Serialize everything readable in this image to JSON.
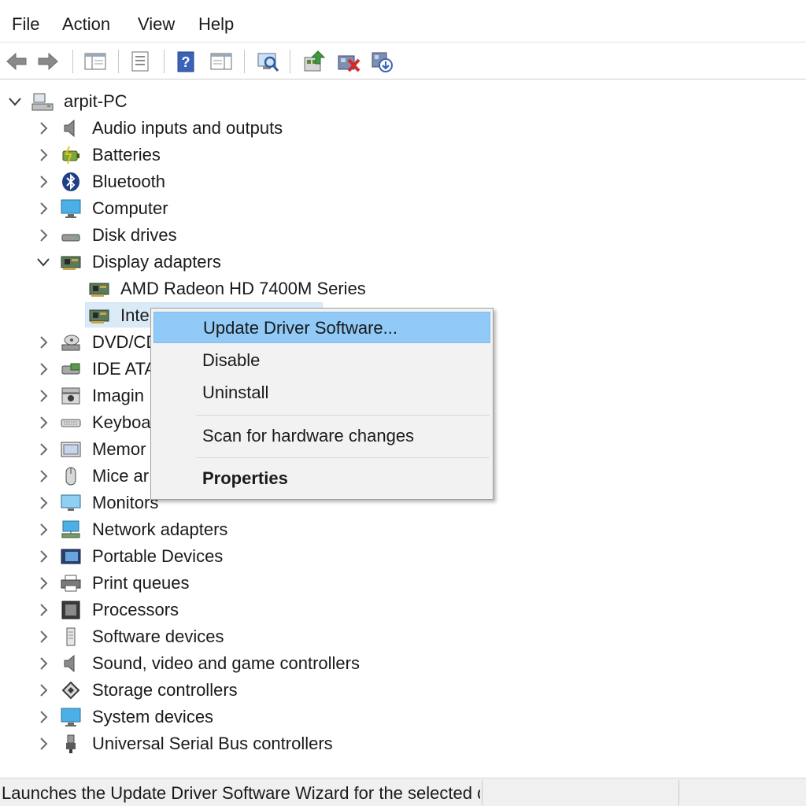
{
  "menubar": {
    "items": [
      {
        "label": "File"
      },
      {
        "label": "Action"
      },
      {
        "label": "View"
      },
      {
        "label": "Help"
      }
    ]
  },
  "toolbar": {
    "buttons": [
      {
        "icon": "back-arrow-icon"
      },
      {
        "icon": "forward-arrow-icon"
      },
      {
        "icon": "show-hide-console-tree-icon"
      },
      {
        "icon": "properties-icon"
      },
      {
        "icon": "help-icon"
      },
      {
        "icon": "action-pane-icon"
      },
      {
        "icon": "scan-hardware-changes-icon"
      },
      {
        "icon": "update-driver-icon"
      },
      {
        "icon": "uninstall-device-icon"
      },
      {
        "icon": "add-legacy-hardware-icon"
      }
    ]
  },
  "tree": {
    "root": {
      "label": "arpit-PC",
      "icon": "computer-icon"
    },
    "nodes": [
      {
        "label": "Audio inputs and outputs",
        "icon": "speaker-icon"
      },
      {
        "label": "Batteries",
        "icon": "battery-icon"
      },
      {
        "label": "Bluetooth",
        "icon": "bluetooth-icon"
      },
      {
        "label": "Computer",
        "icon": "monitor-icon"
      },
      {
        "label": "Disk drives",
        "icon": "disk-drive-icon"
      },
      {
        "label": "Display adapters",
        "icon": "display-adapter-icon",
        "expanded": true
      },
      {
        "label": "AMD Radeon HD 7400M Series",
        "icon": "display-adapter-icon",
        "child": true
      },
      {
        "label": "Inte",
        "icon": "display-adapter-icon",
        "child": true,
        "selected": true
      },
      {
        "label": "DVD/CD",
        "icon": "dvd-drive-icon"
      },
      {
        "label": "IDE ATA",
        "icon": "ide-controller-icon"
      },
      {
        "label": "Imagin",
        "icon": "camera-icon"
      },
      {
        "label": "Keyboa",
        "icon": "keyboard-icon"
      },
      {
        "label": "Memor",
        "icon": "memory-icon"
      },
      {
        "label": "Mice ar",
        "icon": "mouse-icon"
      },
      {
        "label": "Monitors",
        "icon": "monitor-icon"
      },
      {
        "label": "Network adapters",
        "icon": "network-adapter-icon"
      },
      {
        "label": "Portable Devices",
        "icon": "portable-device-icon"
      },
      {
        "label": "Print queues",
        "icon": "printer-icon"
      },
      {
        "label": "Processors",
        "icon": "processor-icon"
      },
      {
        "label": "Software devices",
        "icon": "software-device-icon"
      },
      {
        "label": "Sound, video and game controllers",
        "icon": "speaker-icon"
      },
      {
        "label": "Storage controllers",
        "icon": "storage-controller-icon"
      },
      {
        "label": "System devices",
        "icon": "monitor-icon"
      },
      {
        "label": "Universal Serial Bus controllers",
        "icon": "usb-icon"
      }
    ]
  },
  "context_menu": {
    "items": [
      {
        "label": "Update Driver Software...",
        "highlighted": true
      },
      {
        "label": "Disable"
      },
      {
        "label": "Uninstall"
      },
      {
        "label": "Scan for hardware changes"
      },
      {
        "label": "Properties",
        "bold": true
      }
    ]
  },
  "statusbar": {
    "text": "Launches the Update Driver Software Wizard for the selected d"
  },
  "colors": {
    "selection": "#dbeaf7",
    "menu_highlight": "#91c9f7",
    "menu_background": "#f2f2f2",
    "status_background": "#f0f0f0"
  }
}
